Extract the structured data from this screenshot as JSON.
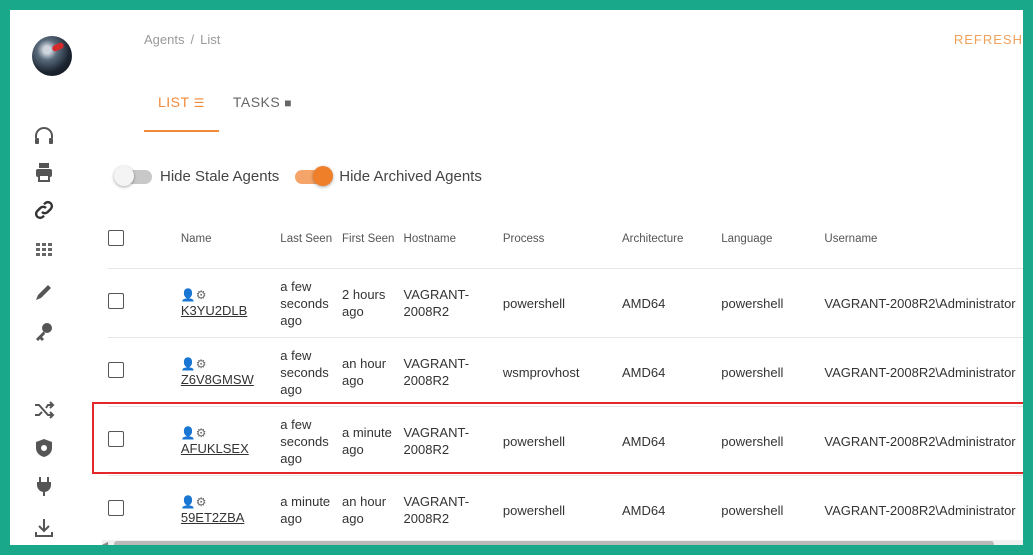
{
  "breadcrumb": {
    "root": "Agents",
    "sep": "/",
    "current": "List"
  },
  "header": {
    "refresh_label": "REFRESH"
  },
  "tabs": [
    {
      "label": "LIST",
      "icon": "list-icon",
      "active": true
    },
    {
      "label": "TASKS",
      "icon": "tasks-icon",
      "active": false
    }
  ],
  "toggles": {
    "hide_stale": {
      "label": "Hide Stale Agents",
      "on": false
    },
    "hide_archived": {
      "label": "Hide Archived Agents",
      "on": true
    }
  },
  "table": {
    "headers": {
      "name": "Name",
      "last_seen": "Last Seen",
      "first_seen": "First Seen",
      "hostname": "Hostname",
      "process": "Process",
      "architecture": "Architecture",
      "language": "Language",
      "username": "Username"
    },
    "rows": [
      {
        "name": "K3YU2DLB",
        "last_seen": "a few seconds ago",
        "first_seen": "2 hours ago",
        "hostname": "VAGRANT-2008R2",
        "process": "powershell",
        "architecture": "AMD64",
        "language": "powershell",
        "username": "VAGRANT-2008R2\\Administrator"
      },
      {
        "name": "Z6V8GMSW",
        "last_seen": "a few seconds ago",
        "first_seen": "an hour ago",
        "hostname": "VAGRANT-2008R2",
        "process": "wsmprovhost",
        "architecture": "AMD64",
        "language": "powershell",
        "username": "VAGRANT-2008R2\\Administrator"
      },
      {
        "name": "AFUKLSEX",
        "last_seen": "a few seconds ago",
        "first_seen": "a minute ago",
        "hostname": "VAGRANT-2008R2",
        "process": "powershell",
        "architecture": "AMD64",
        "language": "powershell",
        "username": "VAGRANT-2008R2\\Administrator",
        "highlighted": true
      },
      {
        "name": "59ET2ZBA",
        "last_seen": "a minute ago",
        "first_seen": "an hour ago",
        "hostname": "VAGRANT-2008R2",
        "process": "powershell",
        "architecture": "AMD64",
        "language": "powershell",
        "username": "VAGRANT-2008R2\\Administrator"
      }
    ]
  },
  "sidebar": {
    "icons": [
      "headphones-icon",
      "printer-icon",
      "link-icon",
      "grid-icon",
      "pencil-icon",
      "key-icon",
      "shuffle-icon",
      "shield-icon",
      "plug-icon",
      "download-icon"
    ]
  },
  "colors": {
    "frame": "#19a98a",
    "accent": "#f08a3b",
    "highlight": "#e32828"
  }
}
